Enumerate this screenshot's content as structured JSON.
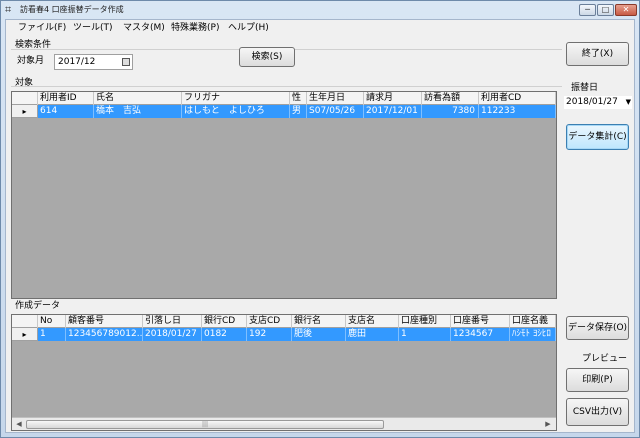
{
  "window": {
    "title": "訪看春4 口座振替データ作成",
    "icon": "app-grid-icon",
    "controls": {
      "minimize": "─",
      "maximize": "□",
      "close": "✕"
    }
  },
  "menu": {
    "items": [
      "ファイル(F)",
      "ツール(T)",
      "マスタ(M)",
      "特殊業務(P)",
      "ヘルプ(H)"
    ]
  },
  "search": {
    "group_label": "検索条件",
    "month_label": "対象月",
    "month_value": "2017/12",
    "search_button": "検索(S)"
  },
  "target_grid": {
    "label": "対象",
    "columns": [
      "利用者ID",
      "氏名",
      "フリガナ",
      "性",
      "生年月日",
      "請求月",
      "訪看為額",
      "利用者CD"
    ],
    "rows": [
      {
        "marker": "▸",
        "cells": [
          "614",
          "橋本　吉弘",
          "はしもと　よしひろ",
          "男",
          "S07/05/26",
          "2017/12/01",
          "7380",
          "112233"
        ]
      }
    ]
  },
  "output_grid": {
    "label": "作成データ",
    "columns": [
      "No",
      "顧客番号",
      "引落し日",
      "銀行CD",
      "支店CD",
      "銀行名",
      "支店名",
      "口座種別",
      "口座番号",
      "口座名義"
    ],
    "rows": [
      {
        "marker": "▸",
        "cells": [
          "1",
          "123456789012...",
          "2018/01/27",
          "0182",
          "192",
          "肥後",
          "鹿田",
          "1",
          "1234567",
          "ﾊｼﾓﾄ ﾖｼﾋﾛ"
        ]
      }
    ]
  },
  "side": {
    "exit_button": "終了(X)",
    "transfer_date_label": "振替日",
    "transfer_date_value": "2018/01/27",
    "aggregate_button": "データ集計(C)",
    "save_button": "データ保存(O)",
    "preview_label": "プレビュー",
    "preview_checked": false,
    "print_button": "印刷(P)",
    "csv_button": "CSV出力(V)"
  },
  "colors": {
    "selection": "#3399ff",
    "grid_background": "#a9a9a9"
  }
}
